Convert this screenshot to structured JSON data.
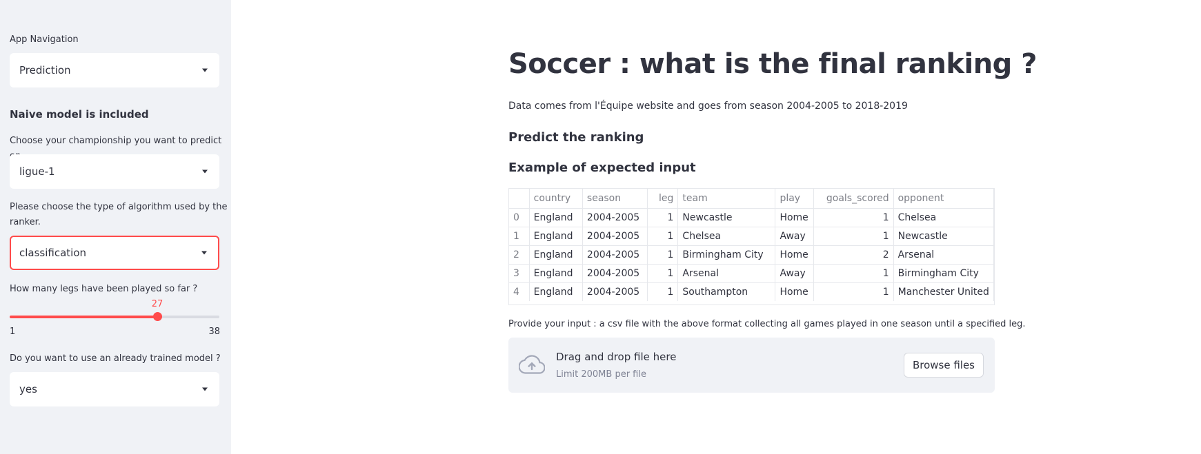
{
  "sidebar": {
    "nav_label": "App Navigation",
    "nav_value": "Prediction",
    "naive_note": "Naive model is included",
    "championship_label": "Choose your championship you want to predict on",
    "championship_value": "ligue-1",
    "algorithm_label_line1": "Please choose the type of algorithm used by the",
    "algorithm_label_line2": "ranker.",
    "algorithm_value": "classification",
    "legs_label": "How many legs have been played so far ?",
    "legs_slider": {
      "min": 1,
      "max": 38,
      "value": 27,
      "min_label": "1",
      "max_label": "38",
      "value_label": "27"
    },
    "trained_label": "Do you want to use an already trained model ?",
    "trained_value": "yes"
  },
  "main": {
    "title": "Soccer : what is the final ranking ?",
    "description": "Data comes from l'Équipe website and goes from season 2004-2005 to 2018-2019",
    "predict_heading": "Predict the ranking",
    "example_heading": "Example of expected input",
    "table": {
      "columns": [
        "",
        "country",
        "season",
        "leg",
        "team",
        "play",
        "goals_scored",
        "opponent"
      ],
      "rows": [
        [
          "0",
          "England",
          "2004-2005",
          "1",
          "Newcastle",
          "Home",
          "1",
          "Chelsea"
        ],
        [
          "1",
          "England",
          "2004-2005",
          "1",
          "Chelsea",
          "Away",
          "1",
          "Newcastle"
        ],
        [
          "2",
          "England",
          "2004-2005",
          "1",
          "Birmingham City",
          "Home",
          "2",
          "Arsenal"
        ],
        [
          "3",
          "England",
          "2004-2005",
          "1",
          "Arsenal",
          "Away",
          "1",
          "Birmingham City"
        ],
        [
          "4",
          "England",
          "2004-2005",
          "1",
          "Southampton",
          "Home",
          "1",
          "Manchester United"
        ]
      ]
    },
    "provide_text": "Provide your input : a csv file with the above format collecting all games played in one season until a specified leg.",
    "uploader": {
      "drop_title": "Drag and drop file here",
      "limit": "Limit 200MB per file",
      "browse_label": "Browse files",
      "icon": "cloud-upload-icon"
    }
  },
  "colors": {
    "accent": "#ff4b4b",
    "sidebar_bg": "#f0f2f6",
    "text": "#31333f"
  }
}
